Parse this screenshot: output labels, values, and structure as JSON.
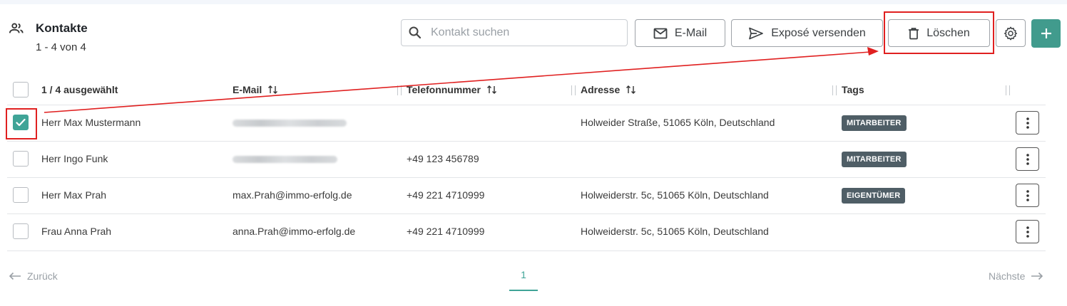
{
  "header": {
    "title": "Kontakte",
    "count_text": "1 - 4 von 4",
    "icon": "people-icon"
  },
  "toolbar": {
    "search_placeholder": "Kontakt suchen",
    "email_label": "E-Mail",
    "expose_label": "Exposé versenden",
    "delete_label": "Löschen",
    "settings_icon": "gear-icon",
    "add_icon": "plus-icon"
  },
  "table": {
    "selection_text": "1 / 4 ausgewählt",
    "columns": {
      "email": "E-Mail",
      "phone": "Telefonnummer",
      "address": "Adresse",
      "tags": "Tags"
    },
    "rows": [
      {
        "checked": true,
        "name": "Herr Max Mustermann",
        "email": "",
        "email_blurred": true,
        "phone": "",
        "address": "Holweider Straße, 51065 Köln, Deutschland",
        "tag": "MITARBEITER"
      },
      {
        "checked": false,
        "name": "Herr Ingo Funk",
        "email": "",
        "email_blurred": true,
        "phone": "+49 123 456789",
        "address": "",
        "tag": "MITARBEITER"
      },
      {
        "checked": false,
        "name": "Herr Max Prah",
        "email": "max.Prah@immo-erfolg.de",
        "email_blurred": false,
        "phone": "+49 221 4710999",
        "address": "Holweiderstr. 5c, 51065 Köln, Deutschland",
        "tag": "EIGENTÜMER"
      },
      {
        "checked": false,
        "name": "Frau Anna Prah",
        "email": "anna.Prah@immo-erfolg.de",
        "email_blurred": false,
        "phone": "+49 221 4710999",
        "address": "Holweiderstr. 5c, 51065 Köln, Deutschland",
        "tag": ""
      }
    ]
  },
  "pagination": {
    "prev_label": "Zurück",
    "next_label": "Nächste",
    "current_page": "1"
  },
  "colors": {
    "accent": "#3fa497",
    "add_button": "#419b8d",
    "tag_bg": "#4f5e66",
    "annotation": "#e02020"
  }
}
